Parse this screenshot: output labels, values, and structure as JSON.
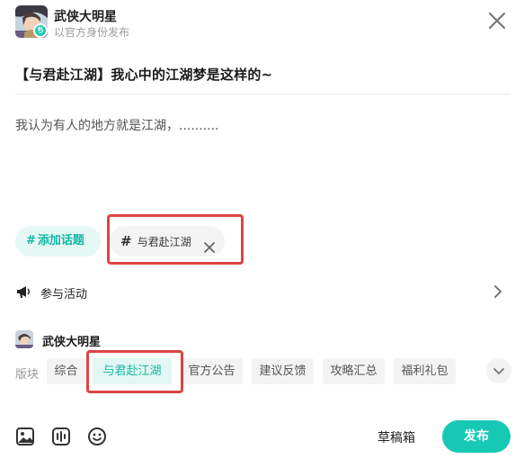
{
  "author": {
    "name": "武侠大明星",
    "subtitle": "以官方身份发布",
    "badge": "ち"
  },
  "post": {
    "title": "【与君赴江湖】我心中的江湖梦是这样的~",
    "body": "我认为有人的地方就是江湖，.........."
  },
  "topics": {
    "add_hash": "#",
    "add_label": "添加话题",
    "selected_hash": "#",
    "selected_label": "与君赴江湖"
  },
  "activity": {
    "label": "参与活动",
    "icon": "megaphone-icon"
  },
  "forum": {
    "name": "武侠大明星",
    "section_label": "版块",
    "sections": [
      {
        "label": "综合",
        "active": false
      },
      {
        "label": "与君赴江湖",
        "active": true
      },
      {
        "label": "官方公告",
        "active": false
      },
      {
        "label": "建议反馈",
        "active": false
      },
      {
        "label": "攻略汇总",
        "active": false
      },
      {
        "label": "福利礼包",
        "active": false
      }
    ]
  },
  "toolbar": {
    "tools": [
      "image-icon",
      "video-icon",
      "emoji-icon"
    ],
    "draft_label": "草稿箱",
    "publish_label": "发布"
  },
  "colors": {
    "accent": "#17c9b5",
    "accent_light": "#e5f8f5",
    "highlight": "#dd4444"
  }
}
